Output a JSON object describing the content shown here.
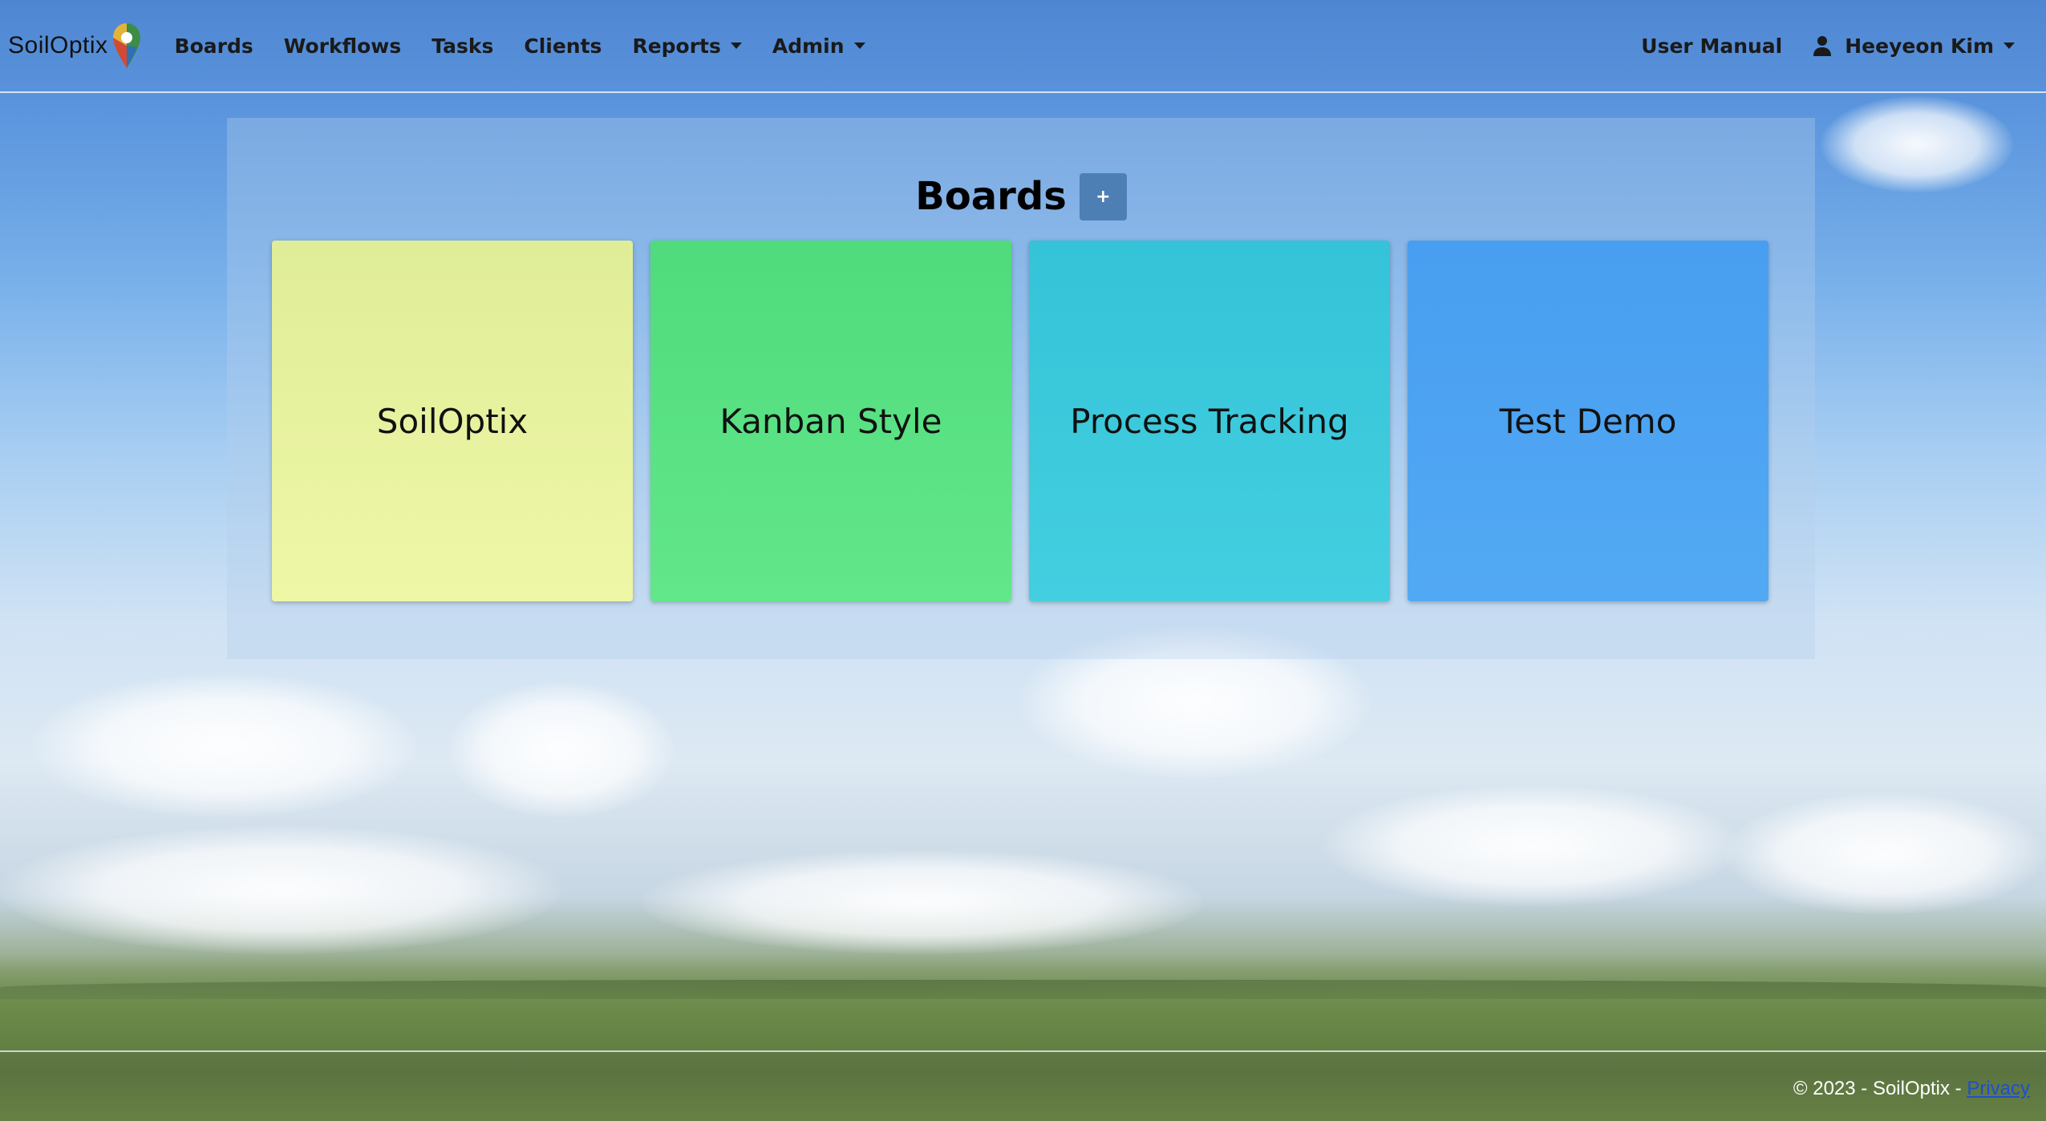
{
  "brand": {
    "name": "SoilOptix"
  },
  "nav": {
    "items": [
      {
        "label": "Boards"
      },
      {
        "label": "Workflows"
      },
      {
        "label": "Tasks"
      },
      {
        "label": "Clients"
      },
      {
        "label": "Reports"
      },
      {
        "label": "Admin"
      }
    ],
    "user_manual": "User Manual",
    "user_name": "Heeyeon Kim"
  },
  "boards": {
    "title": "Boards",
    "add_label": "+",
    "cards": [
      {
        "label": "SoilOptix",
        "color": "#e4efa0"
      },
      {
        "label": "Kanban Style",
        "color": "#55df82"
      },
      {
        "label": "Process Tracking",
        "color": "#3ac8d9"
      },
      {
        "label": "Test Demo",
        "color": "#4aa2f1"
      }
    ]
  },
  "footer": {
    "copyright": "© 2023 - SoilOptix - ",
    "privacy_link": "Privacy"
  }
}
